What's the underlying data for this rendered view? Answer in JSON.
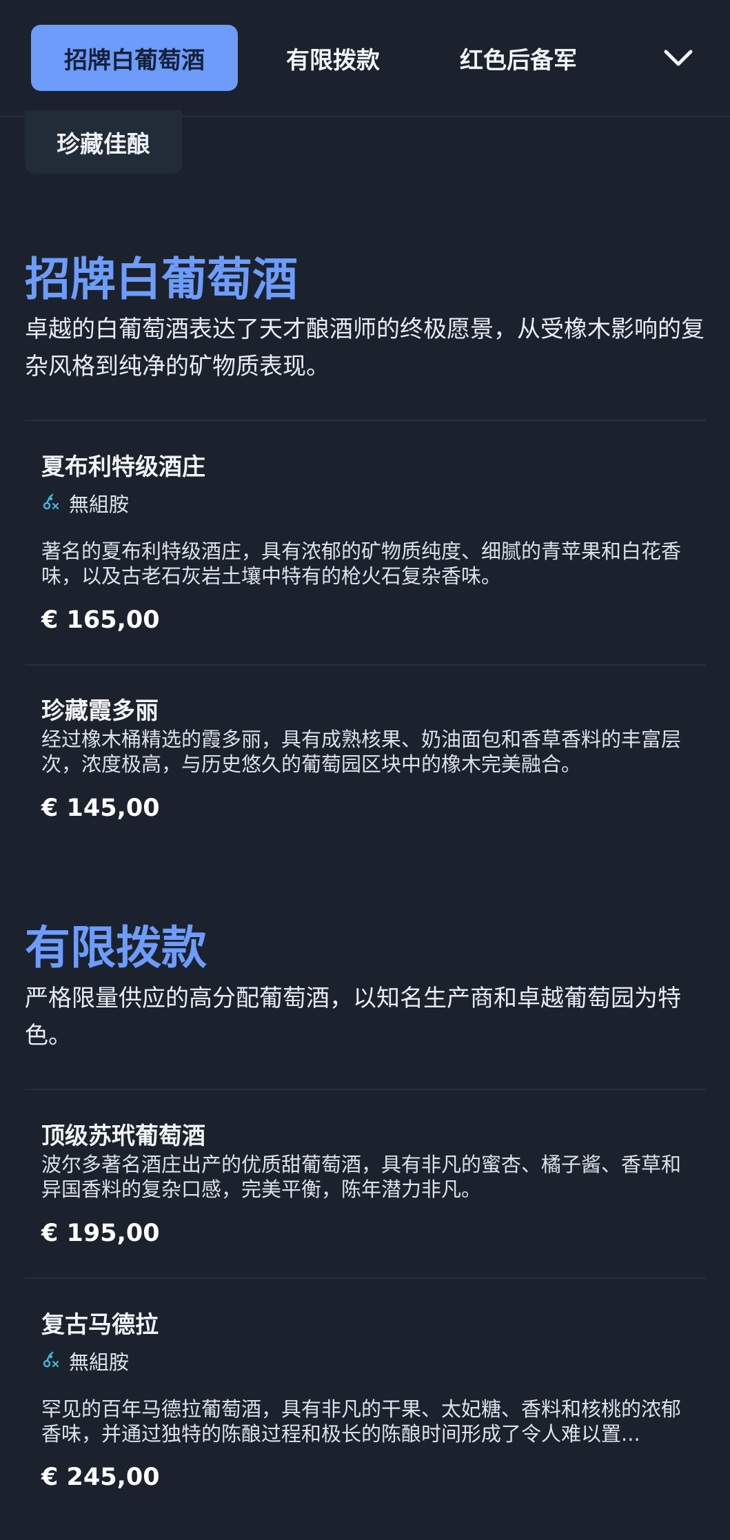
{
  "nav": {
    "tabs": [
      {
        "label": "招牌白葡萄酒",
        "active": true
      },
      {
        "label": "有限拨款",
        "active": false
      },
      {
        "label": "红色后备军",
        "active": false
      },
      {
        "label": "珍藏佳酿",
        "active": false
      }
    ],
    "expand_icon": "chevron-down-icon"
  },
  "sections": [
    {
      "title": "招牌白葡萄酒",
      "description": "卓越的白葡萄酒表达了天才酿酒师的终极愿景，从受橡木影响的复杂风格到纯净的矿物质表现。",
      "items": [
        {
          "name": "夏布利特级酒庄",
          "allergen": {
            "icon": "histamine-free-icon",
            "label": "無組胺"
          },
          "description": "著名的夏布利特级酒庄，具有浓郁的矿物质纯度、细腻的青苹果和白花香味，以及古老石灰岩土壤中特有的枪火石复杂香味。",
          "price": "€ 165,00"
        },
        {
          "name": "珍藏霞多丽",
          "description": "经过橡木桶精选的霞多丽，具有成熟核果、奶油面包和香草香料的丰富层次，浓度极高，与历史悠久的葡萄园区块中的橡木完美融合。",
          "price": "€ 145,00"
        }
      ]
    },
    {
      "title": "有限拨款",
      "description": "严格限量供应的高分配葡萄酒，以知名生产商和卓越葡萄园为特色。",
      "items": [
        {
          "name": "顶级苏玳葡萄酒",
          "description": "波尔多著名酒庄出产的优质甜葡萄酒，具有非凡的蜜杏、橘子酱、香草和异国香料的复杂口感，完美平衡，陈年潜力非凡。",
          "price": "€ 195,00"
        },
        {
          "name": "复古马德拉",
          "allergen": {
            "icon": "histamine-free-icon",
            "label": "無組胺"
          },
          "description": "罕见的百年马德拉葡萄酒，具有非凡的干果、太妃糖、香料和核桃的浓郁香味，并通过独特的陈酿过程和极长的陈酿时间形成了令人难以置...",
          "price": "€ 245,00"
        }
      ]
    }
  ],
  "colors": {
    "background": "#1b222e",
    "accent": "#6d9cfa",
    "allergen_icon": "#3fb8d8"
  }
}
